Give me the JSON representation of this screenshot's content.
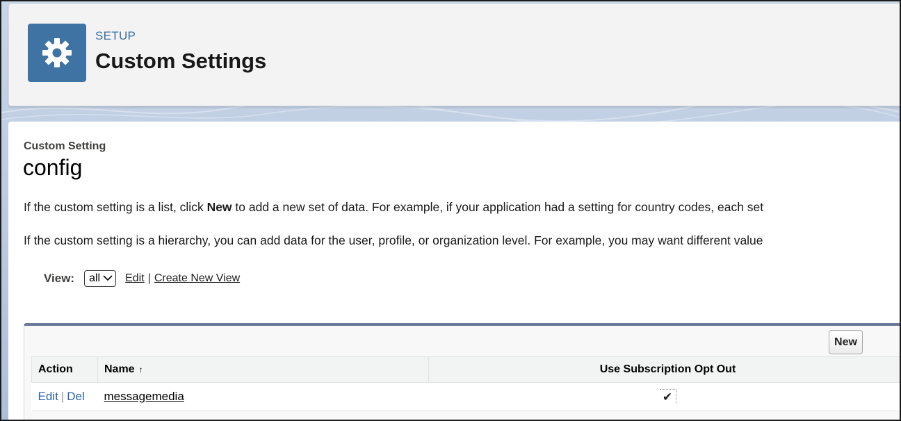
{
  "header": {
    "eyebrow": "SETUP",
    "title": "Custom Settings",
    "icon": "gear-icon"
  },
  "detail": {
    "object_type": "Custom Setting",
    "object_name": "config",
    "desc1_pre": "If the custom setting is a list, click ",
    "desc1_bold": "New",
    "desc1_post": " to add a new set of data. For example, if your application had a setting for country codes, each set",
    "desc2": "If the custom setting is a hierarchy, you can add data for the user, profile, or organization level. For example, you may want different value"
  },
  "view": {
    "label": "View:",
    "selected": "all",
    "edit_link": "Edit",
    "separator": "|",
    "create_link": "Create New View"
  },
  "list": {
    "new_button": "New",
    "columns": {
      "action": "Action",
      "name": "Name",
      "name_sort": "↑",
      "opt_out": "Use Subscription Opt Out"
    },
    "rows": [
      {
        "edit": "Edit",
        "sep": "|",
        "del": "Del",
        "name": "messagemedia",
        "opt_out": "✔"
      }
    ]
  }
}
